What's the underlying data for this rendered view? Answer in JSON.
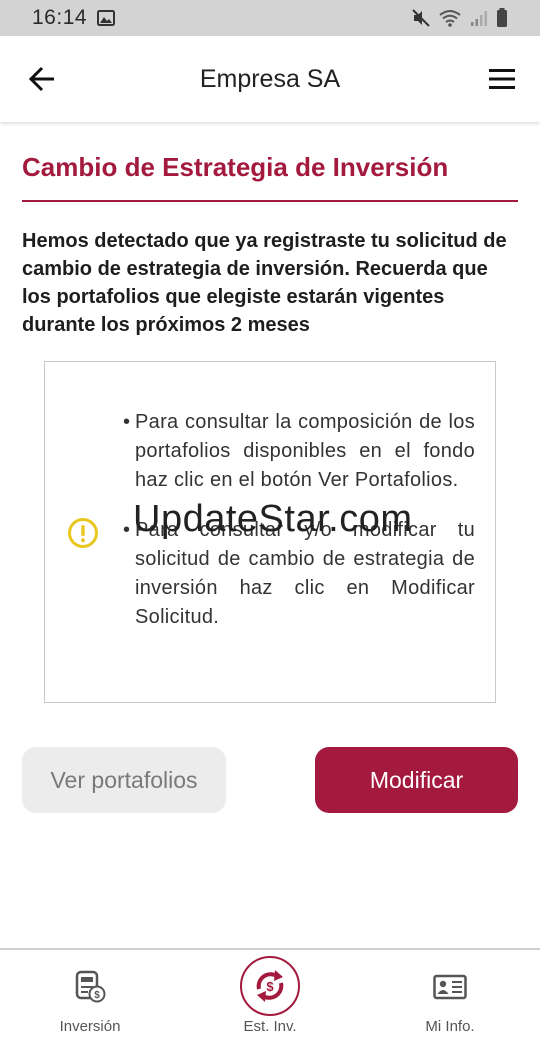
{
  "status_bar": {
    "time": "16:14"
  },
  "app_bar": {
    "title": "Empresa SA"
  },
  "page": {
    "title": "Cambio de Estrategia de Inversión",
    "intro": "Hemos detectado que ya registraste tu solicitud de cambio de estrategia de inversión. Recuerda que los portafolios que elegiste estarán vigentes durante los próximos 2 meses"
  },
  "info_card": {
    "bullets": [
      "Para consultar la composición de los portafolios disponibles en el fondo haz clic en el botón Ver Portafolios.",
      "Para consultar y/o modificar tu solicitud de cambio de estrategia de inversión haz clic en Modificar Solicitud."
    ]
  },
  "watermark": "UpdateStar.com",
  "buttons": {
    "secondary": "Ver portafolios",
    "primary": "Modificar"
  },
  "bottom_nav": [
    {
      "label": "Inversión",
      "icon": "investment-icon"
    },
    {
      "label": "Est. Inv.",
      "icon": "strategy-exchange-icon",
      "active": true
    },
    {
      "label": "Mi Info.",
      "icon": "id-card-icon"
    }
  ],
  "colors": {
    "accent": "#a31a3e",
    "warning": "#e8c81e",
    "secondary_button": "#ececec"
  }
}
